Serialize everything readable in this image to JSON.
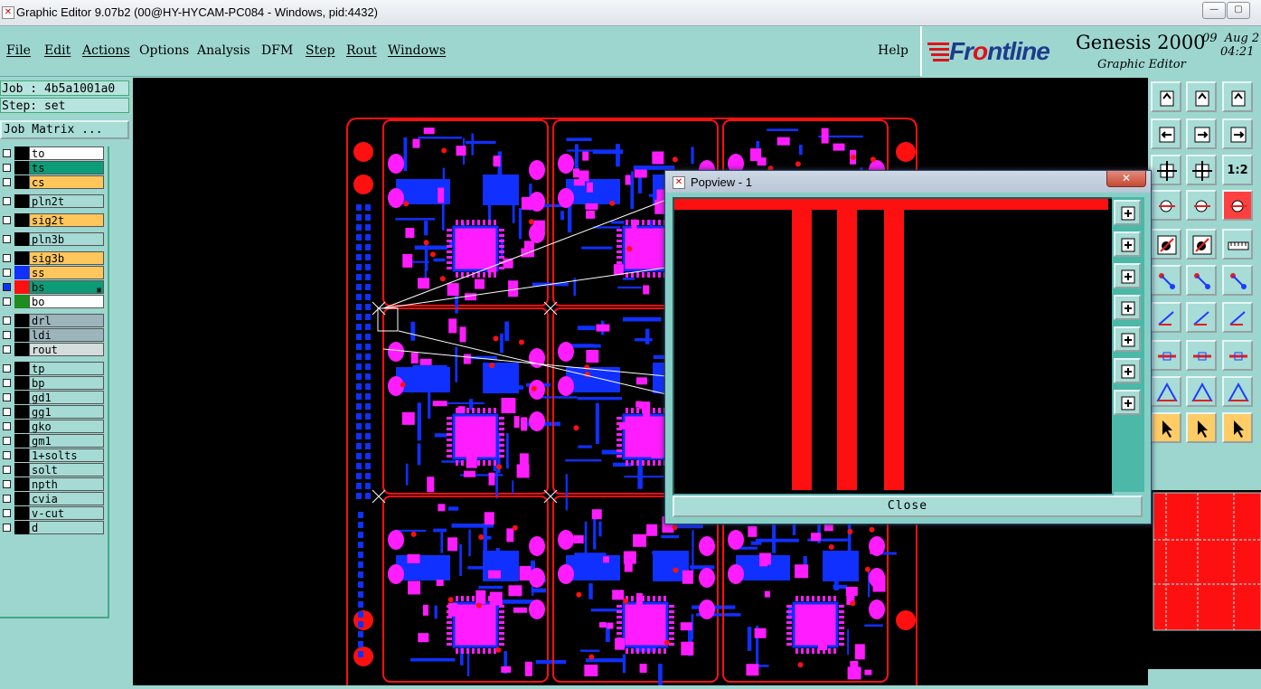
{
  "window": {
    "title": "Graphic Editor 9.07b2 (00@HY-HYCAM-PC084 - Windows, pid:4432)",
    "minimize": "—",
    "maximize": "▢",
    "close": "✕"
  },
  "menu": {
    "file": "File",
    "edit": "Edit",
    "actions": "Actions",
    "options": "Options",
    "analysis": "Analysis",
    "dfm": "DFM",
    "step": "Step",
    "rout": "Rout",
    "windows": "Windows",
    "help": "Help"
  },
  "brand": {
    "logo_a": "Fr",
    "logo_b": "o",
    "logo_c": "ntline",
    "product": "Genesis 2000",
    "subtitle": "Graphic Editor",
    "date_day": "09",
    "date_month": "Aug 2",
    "time": "04:21"
  },
  "job": {
    "job_line": "Job : 4b5a1001a0",
    "step_line": "Step: set",
    "matrix_button": "Job Matrix ..."
  },
  "layers": [
    {
      "name": "to",
      "bg": "#ffffff",
      "swatch": "#000000"
    },
    {
      "name": "ts",
      "bg": "#0d9c78",
      "swatch": "#000000"
    },
    {
      "name": "cs",
      "bg": "#ffc65c",
      "swatch": "#000000"
    },
    {
      "name": "pln2t",
      "bg": "#a6dad4",
      "swatch": "#000000"
    },
    {
      "name": "sig2t",
      "bg": "#ffc65c",
      "swatch": "#000000"
    },
    {
      "name": "pln3b",
      "bg": "#a6dad4",
      "swatch": "#000000"
    },
    {
      "name": "sig3b",
      "bg": "#ffc65c",
      "swatch": "#000000"
    },
    {
      "name": "ss",
      "bg": "#ffc65c",
      "swatch": "#1030ff"
    },
    {
      "name": "bs",
      "bg": "#0d9c78",
      "swatch": "#ff1010",
      "badge": "▣"
    },
    {
      "name": "bo",
      "bg": "#ffffff",
      "swatch": "#1e8c1e"
    },
    {
      "name": "drl",
      "bg": "#9cb4bc",
      "swatch": "#000000"
    },
    {
      "name": "ldi",
      "bg": "#9cb4bc",
      "swatch": "#000000"
    },
    {
      "name": "rout",
      "bg": "#d4dcdc",
      "swatch": "#000000"
    },
    {
      "name": "tp",
      "bg": "#a6dad4",
      "swatch": "#000000"
    },
    {
      "name": "bp",
      "bg": "#a6dad4",
      "swatch": "#000000"
    },
    {
      "name": "gd1",
      "bg": "#a6dad4",
      "swatch": "#000000"
    },
    {
      "name": "gg1",
      "bg": "#a6dad4",
      "swatch": "#000000"
    },
    {
      "name": "gko",
      "bg": "#a6dad4",
      "swatch": "#000000"
    },
    {
      "name": "gm1",
      "bg": "#a6dad4",
      "swatch": "#000000"
    },
    {
      "name": "1+solts",
      "bg": "#a6dad4",
      "swatch": "#000000"
    },
    {
      "name": "solt",
      "bg": "#a6dad4",
      "swatch": "#000000"
    },
    {
      "name": "npth",
      "bg": "#a6dad4",
      "swatch": "#000000"
    },
    {
      "name": "cvia",
      "bg": "#a6dad4",
      "swatch": "#000000"
    },
    {
      "name": "v-cut",
      "bg": "#a6dad4",
      "swatch": "#000000"
    },
    {
      "name": "d",
      "bg": "#a6dad4",
      "swatch": "#000000"
    }
  ],
  "toolbar": {
    "one_to_two_label": "1:2"
  },
  "popview": {
    "title": "Popview - 1",
    "close_x": "✕",
    "close_button": "Close"
  },
  "colors": {
    "panel": "#9dd6cf",
    "outline": "#ff1010",
    "pad": "#ff1cff",
    "trace": "#1030ff"
  }
}
